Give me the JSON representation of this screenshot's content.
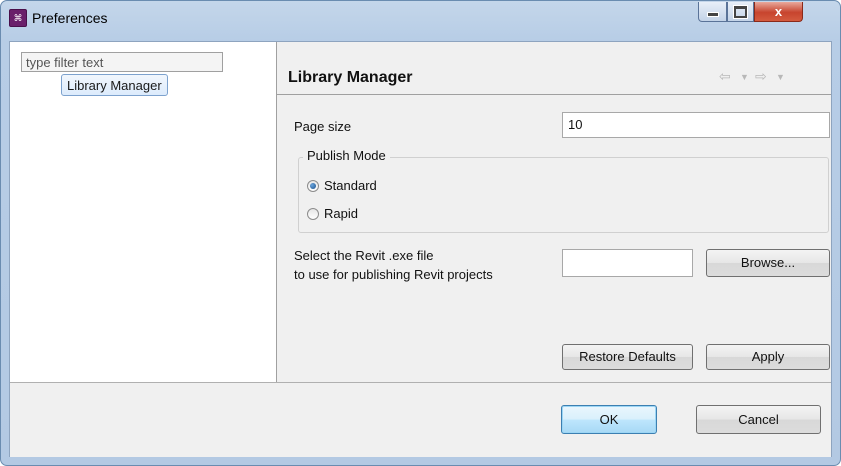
{
  "window": {
    "title": "Preferences",
    "controls": {
      "minimize": "minimize",
      "maximize": "maximize",
      "close": "x"
    }
  },
  "sidebar": {
    "filter_placeholder": "type filter text",
    "items": [
      {
        "label": "Library Manager",
        "selected": true
      }
    ]
  },
  "page": {
    "title": "Library Manager",
    "nav": {
      "back": "⇦",
      "back_menu": "▼",
      "forward": "⇨",
      "forward_menu": "▼"
    },
    "page_size": {
      "label": "Page size",
      "value": "10"
    },
    "publish_mode": {
      "title": "Publish Mode",
      "options": [
        {
          "label": "Standard",
          "selected": true
        },
        {
          "label": "Rapid",
          "selected": false
        }
      ]
    },
    "revit_exe": {
      "label_line1": "Select the Revit .exe file",
      "label_line2": "to use for publishing Revit projects",
      "value": "",
      "browse_label": "Browse..."
    },
    "restore_defaults_label": "Restore Defaults",
    "apply_label": "Apply"
  },
  "footer": {
    "ok_label": "OK",
    "cancel_label": "Cancel"
  },
  "colors": {
    "accent": "#3c7fb1",
    "selection": "#dcebfc",
    "title_bar": "#b7cde6",
    "close_button": "#c7442e"
  }
}
